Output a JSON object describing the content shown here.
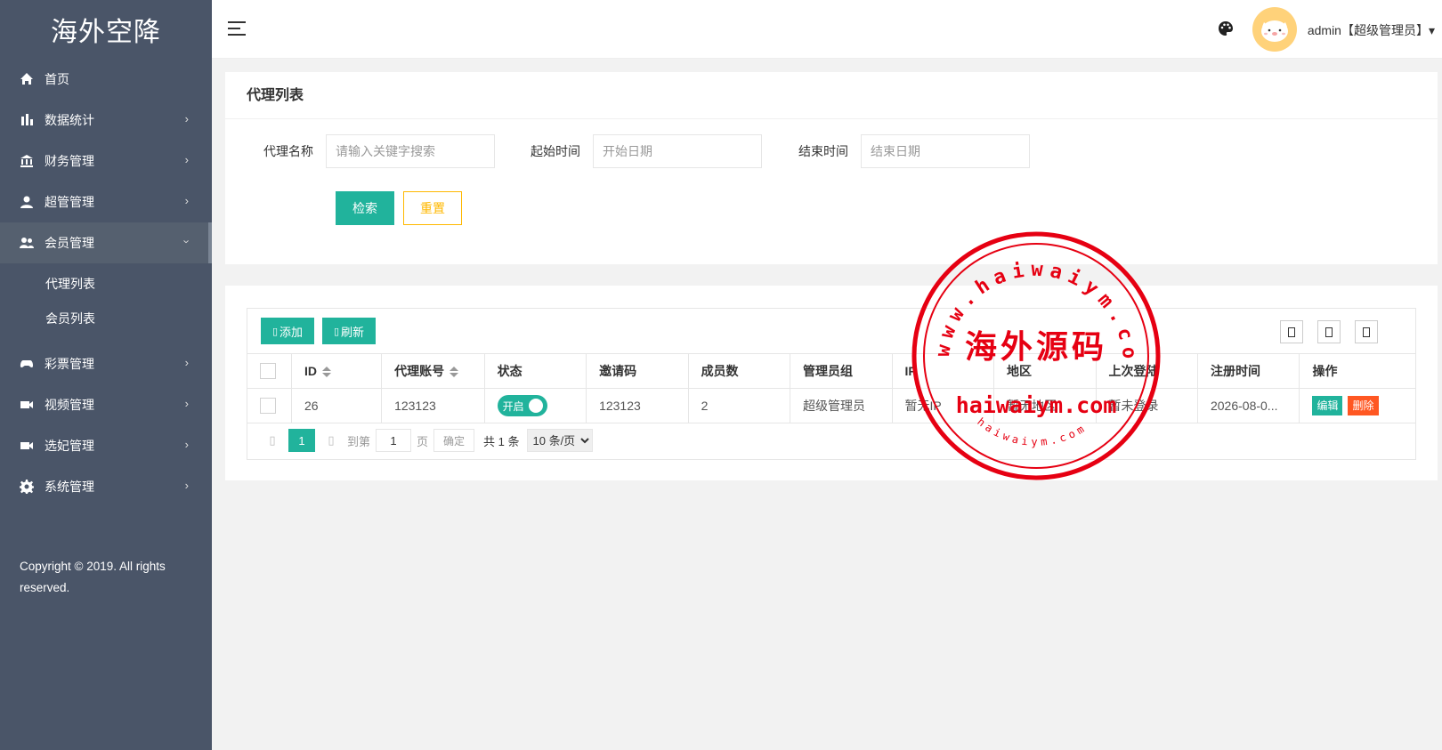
{
  "brand": {
    "title": "海外空降"
  },
  "sidebar": {
    "items": [
      {
        "label": "首页",
        "icon": "home-icon"
      },
      {
        "label": "数据统计",
        "icon": "bar-chart-icon",
        "arrow": "›"
      },
      {
        "label": "财务管理",
        "icon": "bank-icon",
        "arrow": "›"
      },
      {
        "label": "超管管理",
        "icon": "user-icon",
        "arrow": "›"
      },
      {
        "label": "会员管理",
        "icon": "users-icon",
        "arrow": "›"
      },
      {
        "label": "彩票管理",
        "icon": "gamepad-icon",
        "arrow": "›"
      },
      {
        "label": "视频管理",
        "icon": "video-icon",
        "arrow": "›"
      },
      {
        "label": "选妃管理",
        "icon": "video-icon",
        "arrow": "›"
      },
      {
        "label": "系统管理",
        "icon": "gear-icon",
        "arrow": "›"
      }
    ],
    "submenu": [
      {
        "label": "代理列表"
      },
      {
        "label": "会员列表"
      }
    ],
    "copyright": "Copyright © 2019. All rights reserved."
  },
  "header": {
    "user": "admin【超级管理员】▾"
  },
  "search": {
    "title": "代理列表",
    "name_label": "代理名称",
    "name_placeholder": "请输入关键字搜索",
    "start_label": "起始时间",
    "start_placeholder": "开始日期",
    "end_label": "结束时间",
    "end_placeholder": "结束日期",
    "search_button": "检索",
    "reset_button": "重置"
  },
  "toolbar": {
    "add": "添加",
    "refresh": "刷新"
  },
  "table": {
    "columns": [
      "ID",
      "代理账号",
      "状态",
      "邀请码",
      "成员数",
      "管理员组",
      "IP",
      "地区",
      "上次登陆",
      "注册时间",
      "操作"
    ],
    "rows": [
      {
        "id": "26",
        "account": "123123",
        "status": "开启",
        "invite_code": "123123",
        "members": "2",
        "admin_group": "超级管理员",
        "ip": "暂无IP",
        "region": "暂无地区",
        "last_login": "暂未登录",
        "registered": "2026-08-0..."
      }
    ],
    "edit": "编辑",
    "delete": "删除"
  },
  "pagination": {
    "current": "1",
    "goto_label": "到第",
    "goto_value": "1",
    "page_label": "页",
    "confirm": "确定",
    "total": "共 1 条",
    "page_size": "10 条/页"
  },
  "watermark": {
    "top_text": "www.haiwaiym.com",
    "center_text": "海外源码",
    "url_text": "haiwaiym.com",
    "bottom_text": "haiwaiym.com",
    "color": "#e60012"
  }
}
